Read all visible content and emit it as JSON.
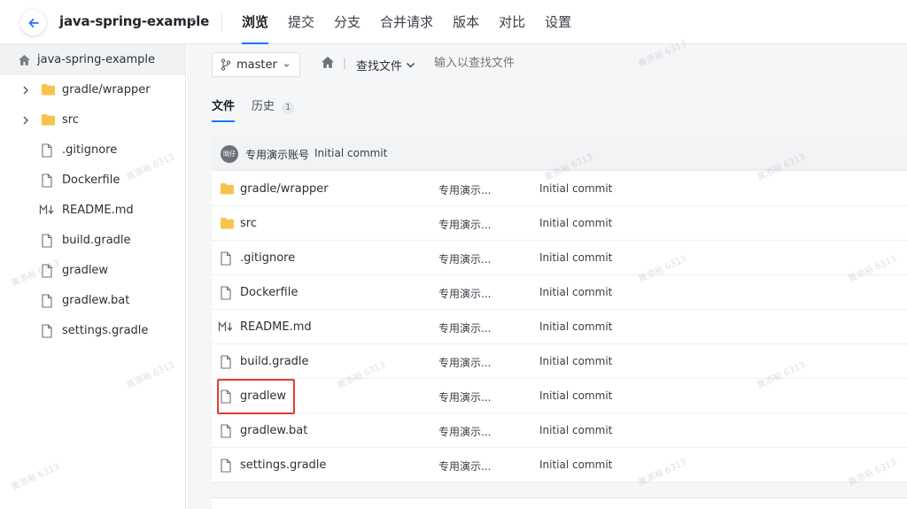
{
  "header": {
    "repo_name": "java-spring-example",
    "nav": [
      "浏览",
      "提交",
      "分支",
      "合并请求",
      "版本",
      "对比",
      "设置"
    ]
  },
  "sidebar": {
    "root": "java-spring-example",
    "items": [
      {
        "label": "gradle/wrapper",
        "type": "folder",
        "expandable": true
      },
      {
        "label": "src",
        "type": "folder",
        "expandable": true
      },
      {
        "label": ".gitignore",
        "type": "file"
      },
      {
        "label": "Dockerfile",
        "type": "file"
      },
      {
        "label": "README.md",
        "type": "markdown"
      },
      {
        "label": "build.gradle",
        "type": "file"
      },
      {
        "label": "gradlew",
        "type": "file"
      },
      {
        "label": "gradlew.bat",
        "type": "file"
      },
      {
        "label": "settings.gradle",
        "type": "file"
      }
    ]
  },
  "toolbar": {
    "branch": "master",
    "find_file": "查找文件",
    "search_placeholder": "输入以查找文件"
  },
  "tabs": {
    "files": "文件",
    "history": "历史",
    "history_count": "1"
  },
  "latest_commit": {
    "avatar_text": "晓仔",
    "author": "专用演示账号",
    "message": "Initial commit"
  },
  "files": [
    {
      "name": "gradle/wrapper",
      "type": "folder",
      "author": "专用演示...",
      "message": "Initial commit"
    },
    {
      "name": "src",
      "type": "folder",
      "author": "专用演示...",
      "message": "Initial commit"
    },
    {
      "name": ".gitignore",
      "type": "file",
      "author": "专用演示...",
      "message": "Initial commit"
    },
    {
      "name": "Dockerfile",
      "type": "file",
      "author": "专用演示...",
      "message": "Initial commit"
    },
    {
      "name": "README.md",
      "type": "markdown",
      "author": "专用演示...",
      "message": "Initial commit"
    },
    {
      "name": "build.gradle",
      "type": "file",
      "author": "专用演示...",
      "message": "Initial commit"
    },
    {
      "name": "gradlew",
      "type": "file",
      "author": "专用演示...",
      "message": "Initial commit"
    },
    {
      "name": "gradlew.bat",
      "type": "file",
      "author": "专用演示...",
      "message": "Initial commit"
    },
    {
      "name": "settings.gradle",
      "type": "file",
      "author": "专用演示...",
      "message": "Initial commit"
    }
  ],
  "watermark_text": "黄添裕 6313",
  "colors": {
    "accent": "#1677ff",
    "folder": "#f7c34b",
    "highlight": "#e53935"
  }
}
